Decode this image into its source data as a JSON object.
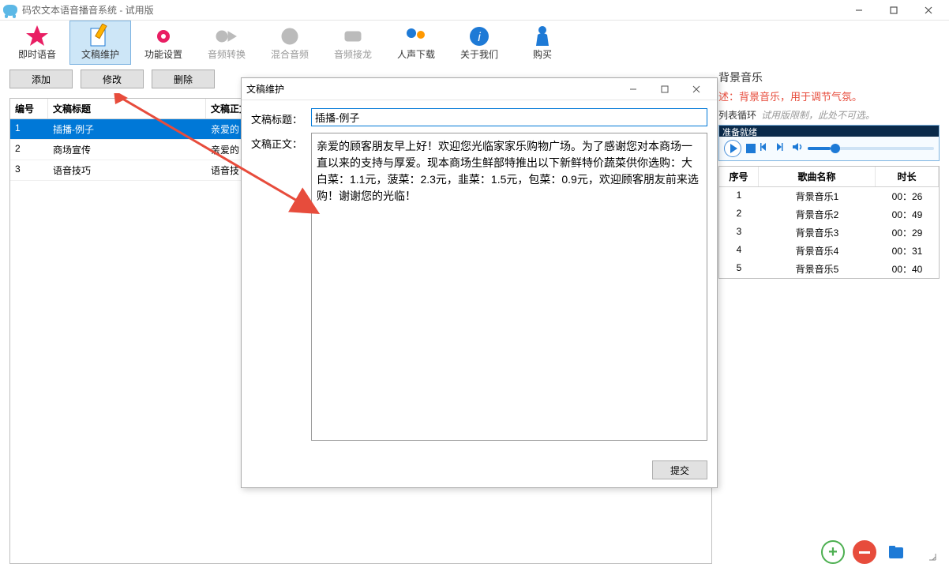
{
  "window": {
    "title": "码农文本语音播音系统 - 试用版"
  },
  "toolbar": {
    "items": [
      {
        "label": "即时语音",
        "icon": "star"
      },
      {
        "label": "文稿维护",
        "icon": "edit",
        "active": true
      },
      {
        "label": "功能设置",
        "icon": "gear"
      },
      {
        "label": "音频转换",
        "icon": "convert",
        "disabled": true
      },
      {
        "label": "混合音频",
        "icon": "mix",
        "disabled": true
      },
      {
        "label": "音频接龙",
        "icon": "chain",
        "disabled": true
      },
      {
        "label": "人声下载",
        "icon": "voice"
      },
      {
        "label": "关于我们",
        "icon": "info"
      },
      {
        "label": "购买",
        "icon": "buy"
      }
    ]
  },
  "left": {
    "buttons": {
      "add": "添加",
      "edit": "修改",
      "del": "删除"
    },
    "columns": {
      "num": "编号",
      "title": "文稿标题",
      "body": "文稿正文"
    },
    "rows": [
      {
        "num": "1",
        "title": "插播-例子",
        "body": "亲爱的"
      },
      {
        "num": "2",
        "title": "商场宣传",
        "body": "亲爱的"
      },
      {
        "num": "3",
        "title": "语音技巧",
        "body": "语音技"
      }
    ]
  },
  "dialog": {
    "title": "文稿维护",
    "label_title": "文稿标题：",
    "label_body": "文稿正文：",
    "value_title": "插播-例子",
    "value_body": "亲爱的顾客朋友早上好！欢迎您光临家家乐购物广场。为了感谢您对本商场一直以来的支持与厚爱。现本商场生鲜部特推出以下新鲜特价蔬菜供你选购：大白菜：1.1元，菠菜：2.3元，韭菜：1.5元，包菜：0.9元，欢迎顾客朋友前来选购！谢谢您的光临！",
    "submit": "提交"
  },
  "right": {
    "section_title": "背景音乐",
    "desc": "述：背景音乐，用于调节气氛。",
    "loop_label": "列表循环",
    "trial_note": "试用版限制，此处不可选。",
    "player_status": "准备就绪",
    "music_columns": {
      "num": "序号",
      "name": "歌曲名称",
      "dur": "时长"
    },
    "music": [
      {
        "num": "1",
        "name": "背景音乐1",
        "dur": "00：26"
      },
      {
        "num": "2",
        "name": "背景音乐2",
        "dur": "00：49"
      },
      {
        "num": "3",
        "name": "背景音乐3",
        "dur": "00：29"
      },
      {
        "num": "4",
        "name": "背景音乐4",
        "dur": "00：31"
      },
      {
        "num": "5",
        "name": "背景音乐5",
        "dur": "00：40"
      }
    ]
  }
}
